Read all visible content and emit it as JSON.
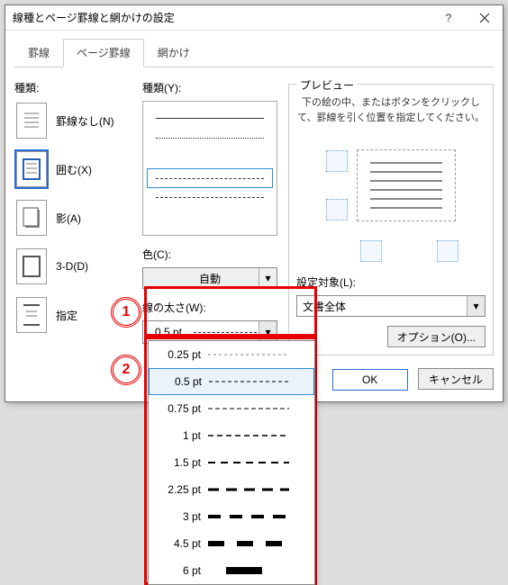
{
  "window": {
    "title": "線種とページ罫線と網かけの設定"
  },
  "tabs": {
    "t1": "罫線",
    "t2": "ページ罫線",
    "t3": "網かけ"
  },
  "left": {
    "group": "種類:",
    "i1": "罫線なし(N)",
    "i2": "囲む(X)",
    "i3": "影(A)",
    "i4": "3-D(D)",
    "i5": "指定"
  },
  "mid": {
    "pattern": "種類(Y):",
    "color": "色(C):",
    "colorval": "自動",
    "width": "線の太さ(W):",
    "widthval": "0.5 pt"
  },
  "right": {
    "legend": "プレビュー",
    "msg": "下の絵の中、またはボタンをクリックして、罫線を引く位置を指定してください。",
    "target": "設定対象(L):",
    "targetval": "文書全体",
    "options": "オプション(O)..."
  },
  "footer": {
    "ok": "OK",
    "cancel": "キャンセル"
  },
  "dropdown": {
    "o1": "0.25 pt",
    "o2": "0.5 pt",
    "o3": "0.75 pt",
    "o4": "1 pt",
    "o5": "1.5 pt",
    "o6": "2.25 pt",
    "o7": "3 pt",
    "o8": "4.5 pt",
    "o9": "6 pt"
  },
  "badges": {
    "b1": "1",
    "b2": "2"
  }
}
